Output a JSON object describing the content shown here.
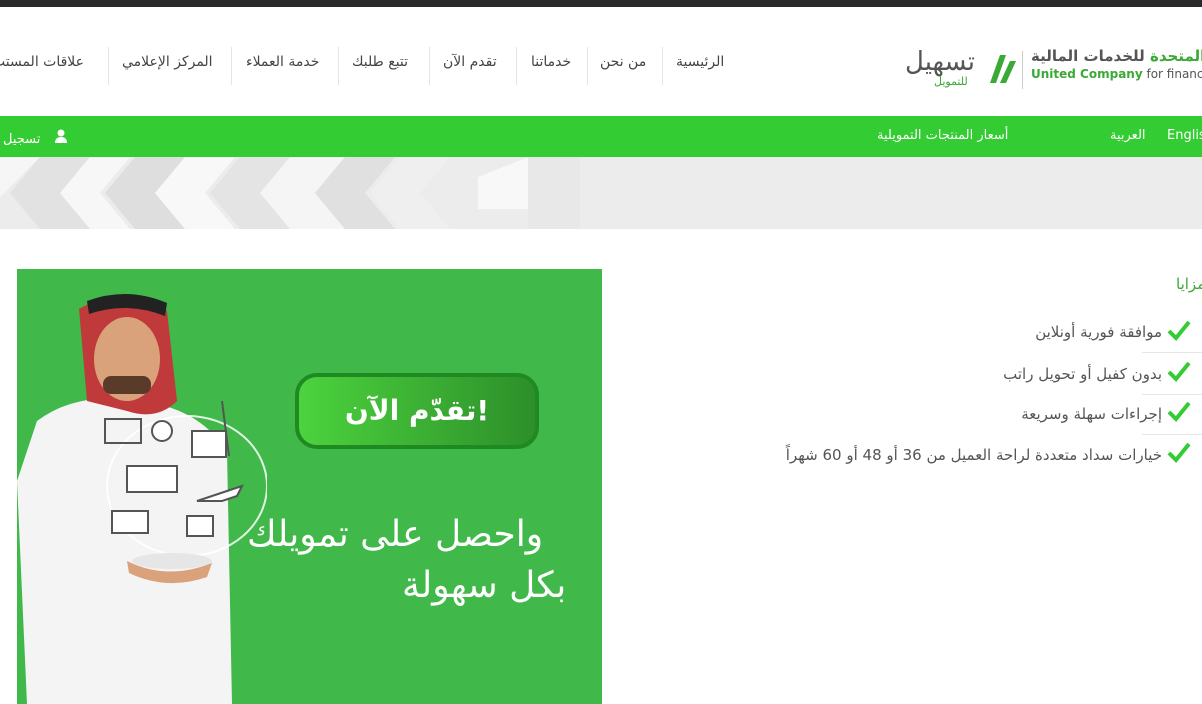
{
  "header": {
    "logo_ar_green": "المتحدة",
    "logo_ar_rest": " للخدمات المالية",
    "logo_en_green": "United Company",
    "logo_en_rest": " for financia",
    "brand_name": "تسهيل",
    "brand_sub": "للتمويل",
    "nav": [
      "الرئيسية",
      "من نحن",
      "خدماتنا",
      "تقدم الآن",
      "تتبع طلبك",
      "خدمة العملاء",
      "المركز الإعلامي",
      "علاقات المستث"
    ]
  },
  "greenbar": {
    "english": "Englis",
    "arabic": "العربية",
    "prices": "أسعار المنتجات التمويلية",
    "register": "تسجيل",
    "user_icon": "user-icon"
  },
  "banner": {
    "cta": "تقدّم الآن!",
    "line1": "واحصل على تمويلك",
    "line2": "بكل سهولة"
  },
  "features": {
    "title": "مزايا",
    "items": [
      "موافقة فورية أونلاين",
      "بدون كفيل أو تحويل راتب",
      "إجراءات سهلة وسريعة",
      "خيارات سداد متعددة لراحة العميل من 36 أو 48 أو 60 شهراً"
    ]
  },
  "colors": {
    "brand_green": "#33cc33",
    "banner_green": "#40b84a",
    "text_green": "#3aa935"
  }
}
